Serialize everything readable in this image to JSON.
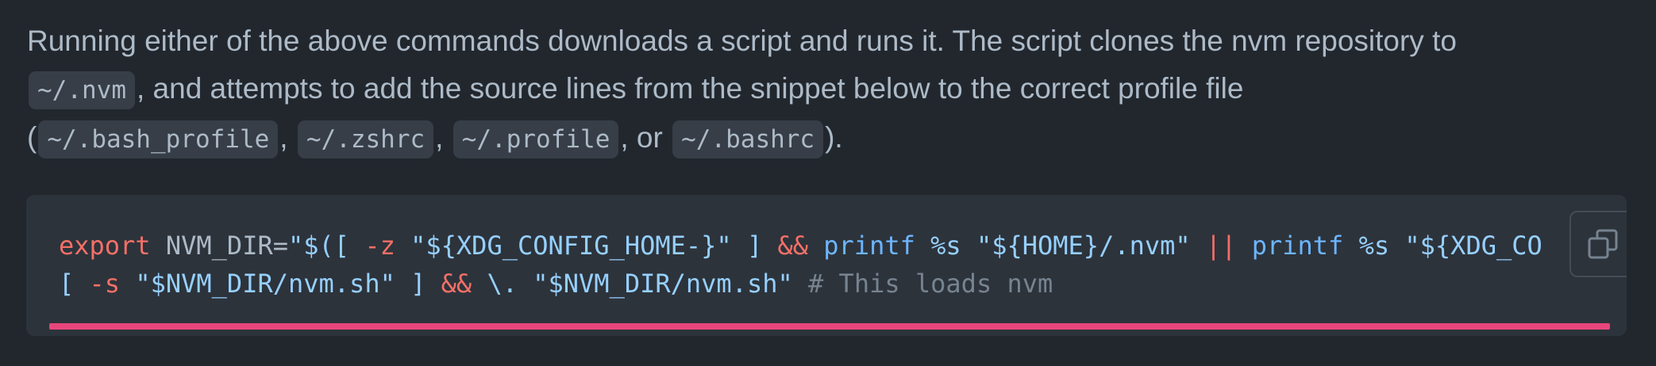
{
  "description": {
    "line1": "Running either of the above commands downloads a script and runs it. The script clones the nvm repository to",
    "code_nvm": "~/.nvm",
    "line2_rest": ", and attempts to add the source lines from the snippet below to the correct profile file",
    "open_paren": "(",
    "code_bash_profile": "~/.bash_profile",
    "comma1": ",",
    "code_zshrc": "~/.zshrc",
    "comma2": ",",
    "code_profile": "~/.profile",
    "or_text": ", or",
    "code_bashrc": "~/.bashrc",
    "close_paren": ")."
  },
  "code_block": {
    "line1": {
      "t1": "export",
      "t2": " NVM_DIR=",
      "t3": "\"$([",
      "t4": " -z ",
      "t5": "\"${XDG_CONFIG_HOME-}\"",
      "t6": " ] ",
      "t7": "&&",
      "t8": " ",
      "t9": "printf",
      "t10": " ",
      "t11": "%s",
      "t12": " \"${HOME}",
      "t13": "/.nvm\"",
      "t14": " ",
      "t15": "||",
      "t16": " ",
      "t17": "printf",
      "t18": " ",
      "t19": "%s",
      "t20": " \"${XDG_CO"
    },
    "line2": {
      "t1": "[ ",
      "t2": "-s",
      "t3": " \"$NVM_DIR",
      "t4": "/nvm.sh\"",
      "t5": " ] ",
      "t6": "&&",
      "t7": " \\. \"$NVM_DIR",
      "t8": "/nvm.sh\"",
      "t9": " ",
      "t10": "# This loads nvm"
    },
    "copy_icon": "copy-icon",
    "progress_fraction": 1.0,
    "progress_color": "#e8457c"
  }
}
